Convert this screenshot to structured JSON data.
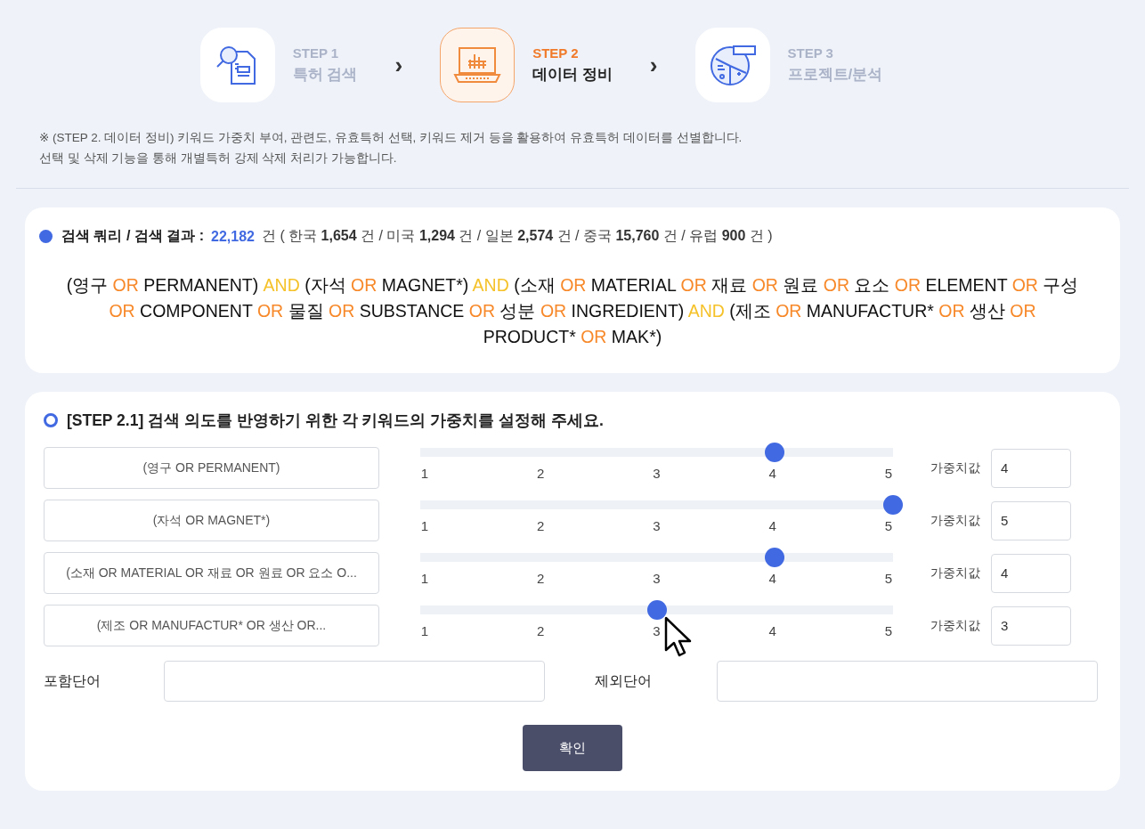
{
  "steps": [
    {
      "kind": "search",
      "label": "STEP 1",
      "name": "특허 검색",
      "selected": false
    },
    {
      "kind": "data",
      "label": "STEP 2",
      "name": "데이터 정비",
      "selected": true
    },
    {
      "kind": "analysis",
      "label": "STEP 3",
      "name": "프로젝트/분석",
      "selected": false
    }
  ],
  "step_separators": [
    "›",
    "›"
  ],
  "notice": [
    "※ (STEP 2. 데이터 정비) 키워드 가중치 부여, 관련도, 유효특허 선택, 키워드 제거 등을 활용하여 유효특허 데이터를 선별합니다.",
    "선택 및 삭제 기능을 통해 개별특허 강제 삭제 처리가 가능합니다."
  ],
  "result": {
    "label": "검색 쿼리 / 검색 결과 :",
    "total": "22,182",
    "detail": "건 ( 한국 **1,654** 건 / 미국 **1,294** 건 / 일본 **2,574** 건 / 중국 **15,760** 건 / 유럽 **900** 건 )",
    "query": [
      {
        "kind": "text",
        "text": "(영구 "
      },
      {
        "kind": "or",
        "text": "OR"
      },
      {
        "kind": "text",
        "text": " PERMANENT) "
      },
      {
        "kind": "and",
        "text": "AND"
      },
      {
        "kind": "text",
        "text": " (자석 "
      },
      {
        "kind": "or",
        "text": "OR"
      },
      {
        "kind": "text",
        "text": " MAGNET*) "
      },
      {
        "kind": "and",
        "text": "AND"
      },
      {
        "kind": "text",
        "text": " (소재 "
      },
      {
        "kind": "or",
        "text": "OR"
      },
      {
        "kind": "text",
        "text": " MATERIAL "
      },
      {
        "kind": "or",
        "text": "OR"
      },
      {
        "kind": "text",
        "text": " 재료 "
      },
      {
        "kind": "or",
        "text": "OR"
      },
      {
        "kind": "text",
        "text": " 원료 "
      },
      {
        "kind": "or",
        "text": "OR"
      },
      {
        "kind": "text",
        "text": " 요소 "
      },
      {
        "kind": "or",
        "text": "OR"
      },
      {
        "kind": "text",
        "text": " ELEMENT "
      },
      {
        "kind": "or",
        "text": "OR"
      },
      {
        "kind": "text",
        "text": " 구성 "
      },
      {
        "kind": "or",
        "text": "OR"
      },
      {
        "kind": "text",
        "text": " COMPONENT "
      },
      {
        "kind": "or",
        "text": "OR"
      },
      {
        "kind": "text",
        "text": " 물질 "
      },
      {
        "kind": "or",
        "text": "OR"
      },
      {
        "kind": "text",
        "text": " SUBSTANCE "
      },
      {
        "kind": "or",
        "text": "OR"
      },
      {
        "kind": "text",
        "text": " 성분 "
      },
      {
        "kind": "or",
        "text": "OR"
      },
      {
        "kind": "text",
        "text": " INGREDIENT) "
      },
      {
        "kind": "and",
        "text": "AND"
      },
      {
        "kind": "text",
        "text": " (제조 "
      },
      {
        "kind": "or",
        "text": "OR"
      },
      {
        "kind": "text",
        "text": " MANUFACTUR* "
      },
      {
        "kind": "or",
        "text": "OR"
      },
      {
        "kind": "text",
        "text": " 생산 "
      },
      {
        "kind": "or",
        "text": "OR"
      },
      {
        "kind": "text",
        "text": " PRODUCT* "
      },
      {
        "kind": "or",
        "text": "OR"
      },
      {
        "kind": "text",
        "text": " MAK*)"
      }
    ]
  },
  "weights": {
    "title": "[STEP 2.1] 검색 의도를 반영하기 위한 각 키워드의 가중치를 설정해 주세요.",
    "rows": [
      {
        "keyword": "(영구 OR PERMANENT)",
        "level": 0.75,
        "ticks": [
          "1",
          "2",
          "3",
          "4",
          "5"
        ],
        "weight_label": "가중치값",
        "weight": "4"
      },
      {
        "keyword": "(자석 OR MAGNET*)",
        "level": 1,
        "ticks": [
          "1",
          "2",
          "3",
          "4",
          "5"
        ],
        "weight_label": "가중치값",
        "weight": "5"
      },
      {
        "keyword": "(소재 OR MATERIAL OR 재료 OR 원료 OR 요소 O...",
        "level": 0.75,
        "ticks": [
          "1",
          "2",
          "3",
          "4",
          "5"
        ],
        "weight_label": "가중치값",
        "weight": "4"
      },
      {
        "keyword": "(제조 OR MANUFACTUR* OR 생산 OR...",
        "level": 0.5,
        "ticks": [
          "1",
          "2",
          "3",
          "4",
          "5"
        ],
        "weight_label": "가중치값",
        "weight": "3"
      }
    ],
    "include_label": "포함단어",
    "exclude_label": "제외단어",
    "confirm": "확인"
  }
}
